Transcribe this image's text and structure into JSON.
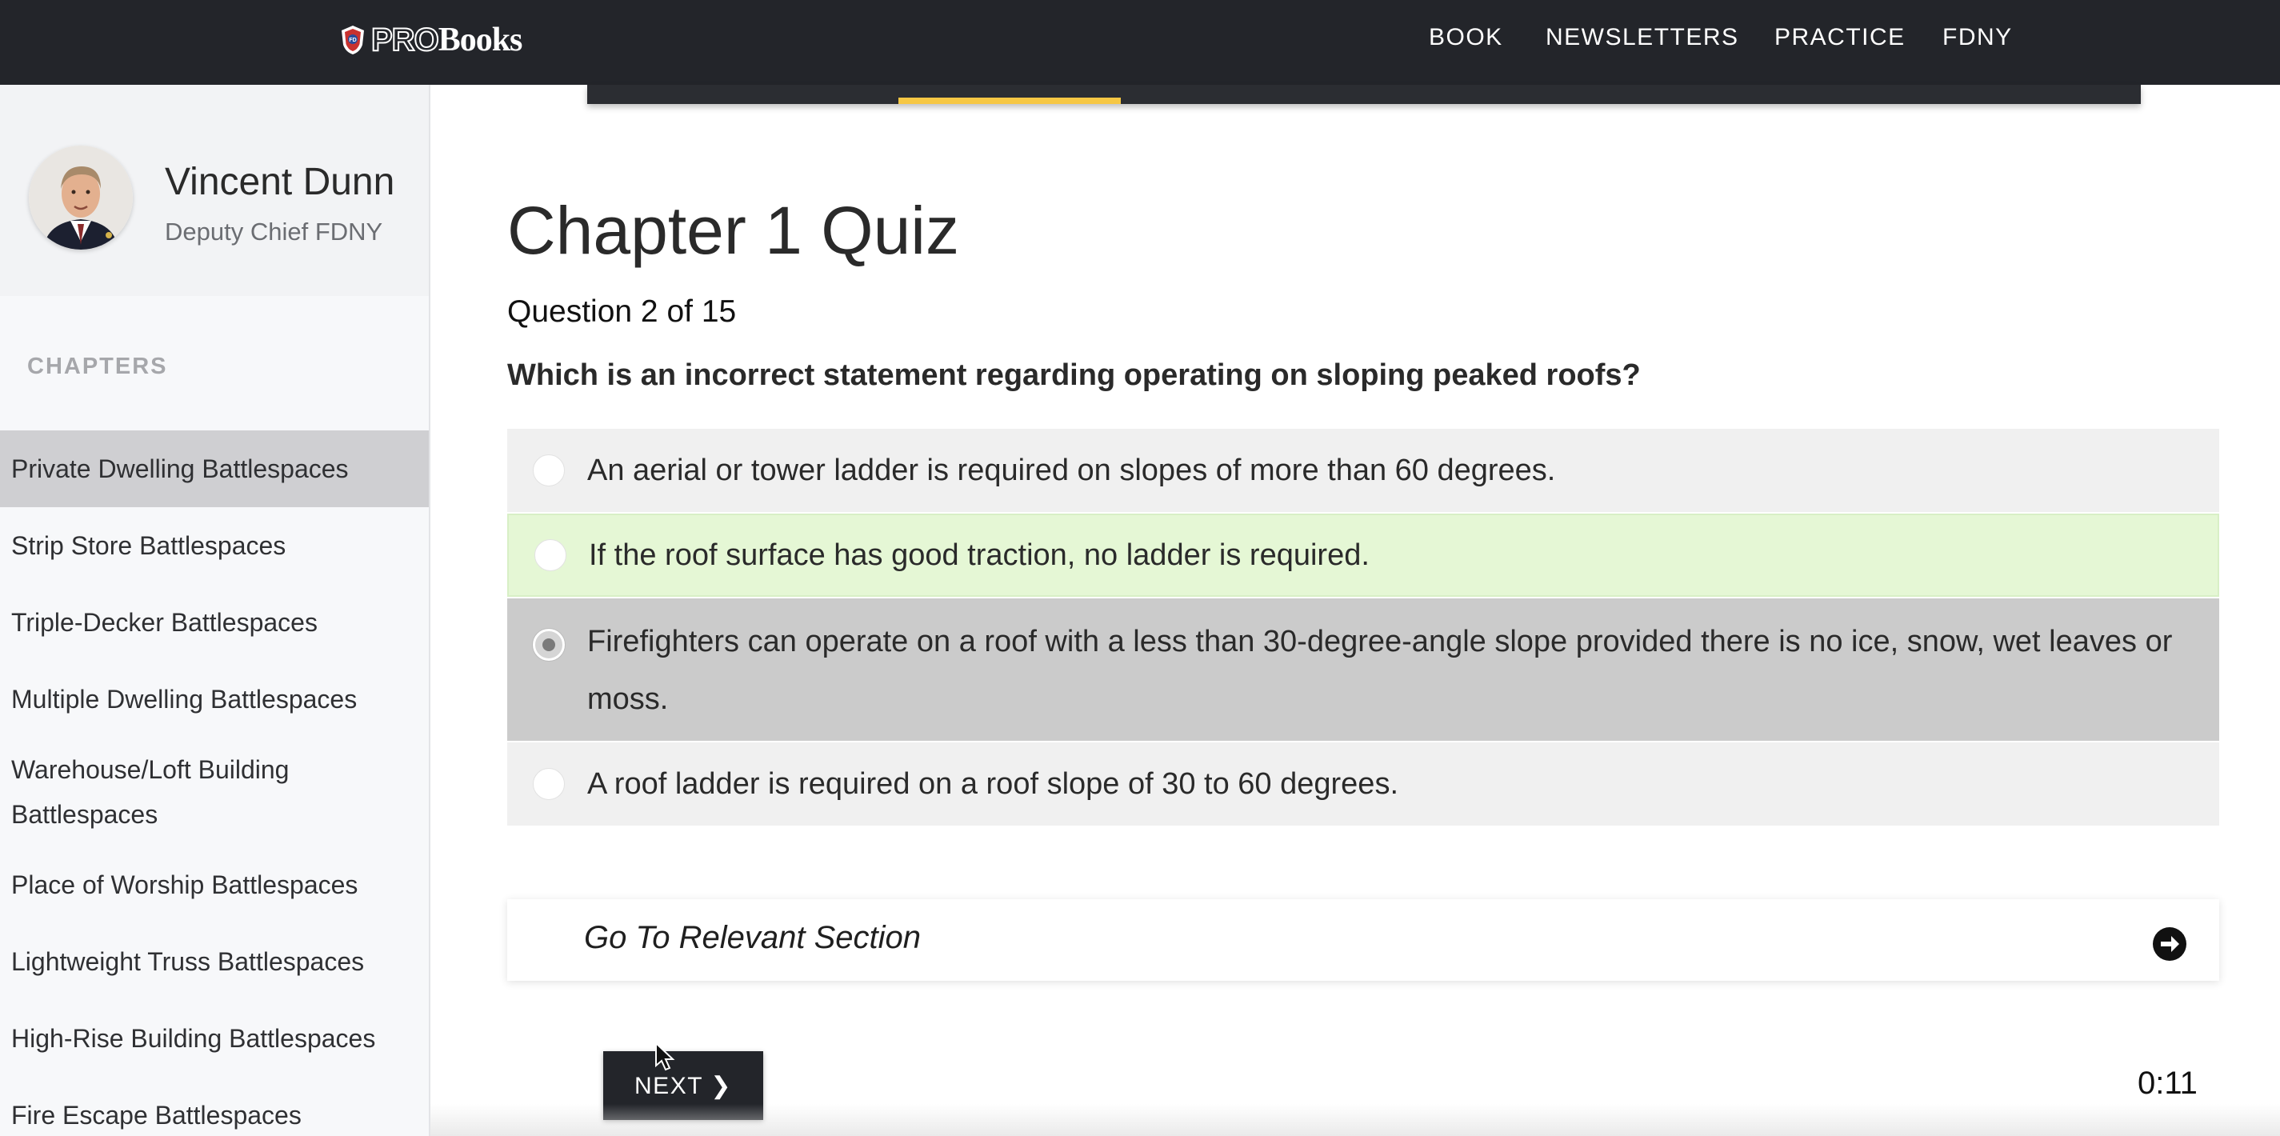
{
  "header": {
    "logo_pro": "PRO",
    "logo_books": "Books",
    "nav": [
      "BOOK",
      "NEWSLETTERS",
      "PRACTICE",
      "FDNY"
    ]
  },
  "sidebar": {
    "profile": {
      "name": "Vincent Dunn",
      "title": "Deputy Chief FDNY"
    },
    "chapters_heading": "CHAPTERS",
    "chapters": [
      "Private Dwelling Battlespaces",
      "Strip Store Battlespaces",
      "Triple-Decker Battlespaces",
      "Multiple Dwelling Battlespaces",
      "Warehouse/Loft Building Battlespaces",
      "Place of Worship Battlespaces",
      "Lightweight Truss Battlespaces",
      "High-Rise Building Battlespaces",
      "Fire Escape Battlespaces"
    ],
    "active_chapter_index": 0
  },
  "quiz": {
    "title": "Chapter 1 Quiz",
    "progress": "Question 2 of 15",
    "question": "Which is an incorrect statement regarding operating on sloping peaked roofs?",
    "answers": [
      {
        "text": "An aerial or tower ladder is required on slopes of more than 60 degrees.",
        "state": "default"
      },
      {
        "text": "If the roof surface has good traction, no ladder is required.",
        "state": "correct"
      },
      {
        "text": "Firefighters can operate on a roof with a less than 30-degree-angle slope provided there is no ice, snow, wet leaves or moss.",
        "state": "selected"
      },
      {
        "text": "A roof ladder is required on a roof slope of 30 to 60 degrees.",
        "state": "default"
      }
    ],
    "relevant_label": "Go To Relevant Section",
    "next_label": "NEXT ❯",
    "timer": "0:11"
  },
  "colors": {
    "navbar": "#23252a",
    "accent": "#f6c744",
    "correct_bg": "#e5f7d5",
    "selected_bg": "#cbcbcb"
  }
}
